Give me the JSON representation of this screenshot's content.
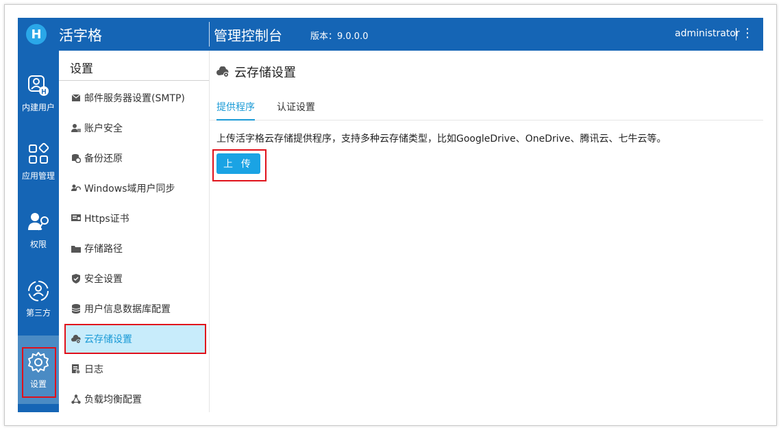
{
  "header": {
    "logo_letter": "H",
    "app_name": "活字格",
    "console_title": "管理控制台",
    "version_label": "版本：9.0.0.0",
    "user": "administrator"
  },
  "rail": {
    "items": [
      {
        "label": "内建用户",
        "icon": "user-h-icon"
      },
      {
        "label": "应用管理",
        "icon": "apps-grid-icon"
      },
      {
        "label": "权限",
        "icon": "user-key-icon"
      },
      {
        "label": "第三方",
        "icon": "third-party-icon"
      },
      {
        "label": "设置",
        "icon": "gear-icon",
        "active": true
      }
    ]
  },
  "sidebar": {
    "title": "设置",
    "items": [
      {
        "label": "邮件服务器设置(SMTP)",
        "icon": "mail-icon"
      },
      {
        "label": "账户安全",
        "icon": "user-lock-icon"
      },
      {
        "label": "备份还原",
        "icon": "backup-icon"
      },
      {
        "label": "Windows域用户同步",
        "icon": "user-sync-icon"
      },
      {
        "label": "Https证书",
        "icon": "certificate-icon"
      },
      {
        "label": "存储路径",
        "icon": "folder-icon"
      },
      {
        "label": "安全设置",
        "icon": "shield-icon"
      },
      {
        "label": "用户信息数据库配置",
        "icon": "database-icon"
      },
      {
        "label": "云存储设置",
        "icon": "cloud-gear-icon",
        "active": true
      },
      {
        "label": "日志",
        "icon": "log-icon"
      },
      {
        "label": "负载均衡配置",
        "icon": "network-icon"
      }
    ]
  },
  "main": {
    "title": "云存储设置",
    "tabs": [
      {
        "label": "提供程序",
        "active": true
      },
      {
        "label": "认证设置"
      }
    ],
    "description": "上传活字格云存储提供程序，支持多种云存储类型，比如GoogleDrive、OneDrive、腾讯云、七牛云等。",
    "upload_label": "上 传"
  },
  "colors": {
    "brand": "#1565b5",
    "accent": "#1a9ad6",
    "button": "#1aa3e4",
    "highlight": "#e0101a"
  }
}
